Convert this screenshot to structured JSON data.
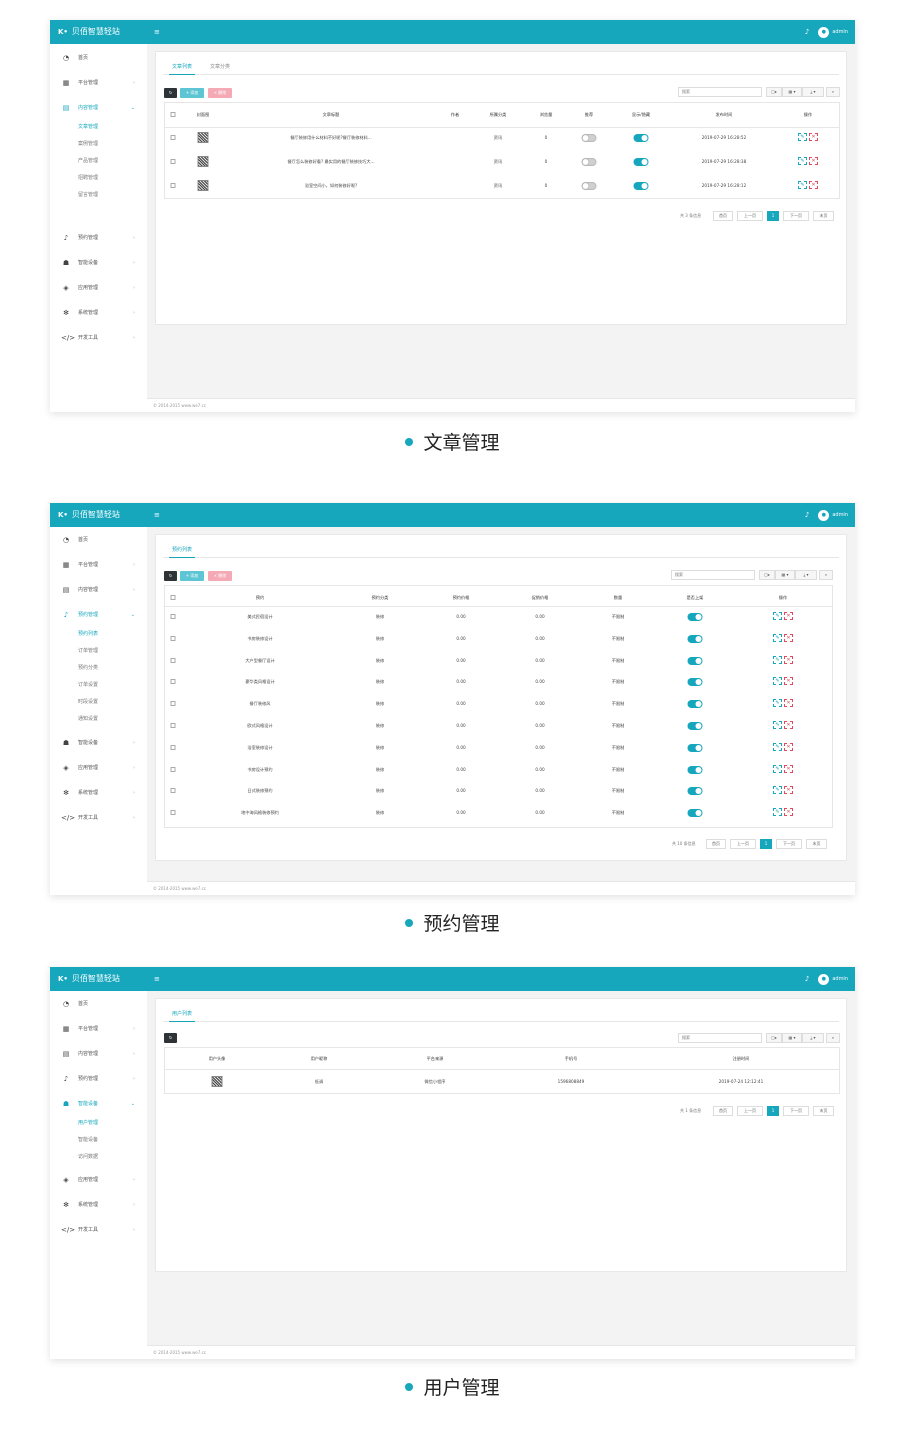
{
  "app": {
    "logo_mark": "K•",
    "title": "贝佰智慧轻站",
    "menu_toggle": "≡",
    "bell": "♪",
    "avatar": "●",
    "user": "admin",
    "footer": "© 2014-2015 www.we7.cc",
    "accent_color": "#17a7bd"
  },
  "sidebar_labels": {
    "home": "首页",
    "platform": "平台管理",
    "content": "内容管理",
    "booking": "预约管理",
    "member": "智能设备",
    "app": "应用管理",
    "system": "系统管理",
    "dev": "开发工具",
    "arrow": "›"
  },
  "content_sub": [
    "文章管理",
    "案例管理",
    "产品管理",
    "招聘管理",
    "留言管理"
  ],
  "booking_sub": [
    "预约列表",
    "订单管理",
    "预约分类",
    "订单设置",
    "时段设置",
    "通知设置"
  ],
  "member_sub": [
    "用户管理",
    "智能设备",
    "访问数据"
  ],
  "toolbar": {
    "refresh": "↻",
    "add": "+ 添加",
    "delete": "× 删除",
    "search_placeholder": "搜索",
    "view": "▢▸",
    "columns": "▦ ▾",
    "export": "⤓ ▾",
    "search_btn": "⌕"
  },
  "pager": {
    "first": "首页",
    "prev": "上一页",
    "current": "1",
    "next": "下一页",
    "last": "末页"
  },
  "ops": {
    "edit": "✎",
    "delete": "✕"
  },
  "article": {
    "tabs": [
      "文章列表",
      "文章分类"
    ],
    "headers": [
      "封面图",
      "文章标题",
      "作者",
      "所属分类",
      "浏览量",
      "推荐",
      "显示/隐藏",
      "发布时间",
      "操作"
    ],
    "rows": [
      {
        "title": "餐厅装修用什么材料不好呢?餐厅装修材料...",
        "author": "",
        "category": "资讯",
        "views": "0",
        "recommend": false,
        "visible": true,
        "time": "2019-07-29 16:28:52"
      },
      {
        "title": "餐厅怎么装修好看? 最实用的餐厅装修技巧大...",
        "author": "",
        "category": "资讯",
        "views": "0",
        "recommend": false,
        "visible": true,
        "time": "2019-07-29 16:28:38"
      },
      {
        "title": "浴室空间小，如何装修好呢?",
        "author": "",
        "category": "资讯",
        "views": "0",
        "recommend": false,
        "visible": true,
        "time": "2019-07-29 16:28:12"
      }
    ],
    "total": "共 3 条信息"
  },
  "booking": {
    "tabs": [
      "预约列表"
    ],
    "headers": [
      "预约",
      "预约分类",
      "预约价格",
      "促销价格",
      "数量",
      "是否上架",
      "操作"
    ],
    "rows": [
      {
        "name": "美式民宿设计",
        "category": "装修",
        "price": "0.00",
        "promo": "0.00",
        "qty": "不限制",
        "on": true
      },
      {
        "name": "书房装修设计",
        "category": "装修",
        "price": "0.00",
        "promo": "0.00",
        "qty": "不限制",
        "on": true
      },
      {
        "name": "大户型餐厅设计",
        "category": "装修",
        "price": "0.00",
        "promo": "0.00",
        "qty": "不限制",
        "on": true
      },
      {
        "name": "豪华类风格设计",
        "category": "装修",
        "price": "0.00",
        "promo": "0.00",
        "qty": "不限制",
        "on": true
      },
      {
        "name": "餐厅装修风",
        "category": "装修",
        "price": "0.00",
        "promo": "0.00",
        "qty": "不限制",
        "on": true
      },
      {
        "name": "欧式风格设计",
        "category": "装修",
        "price": "0.00",
        "promo": "0.00",
        "qty": "不限制",
        "on": true
      },
      {
        "name": "浴室装修设计",
        "category": "装修",
        "price": "0.00",
        "promo": "0.00",
        "qty": "不限制",
        "on": true
      },
      {
        "name": "书房设计预约",
        "category": "装修",
        "price": "0.00",
        "promo": "0.00",
        "qty": "不限制",
        "on": true
      },
      {
        "name": "日式装修预约",
        "category": "装修",
        "price": "0.00",
        "promo": "0.00",
        "qty": "不限制",
        "on": true
      },
      {
        "name": "地中海风格装修预约",
        "category": "装修",
        "price": "0.00",
        "promo": "0.00",
        "qty": "不限制",
        "on": true
      }
    ],
    "total": "共 10 条信息"
  },
  "users": {
    "tabs": [
      "用户列表"
    ],
    "headers": [
      "用户头像",
      "用户昵称",
      "平台来源",
      "手机号",
      "注册时间"
    ],
    "rows": [
      {
        "nickname": "低调",
        "source": "微信小程序",
        "phone": "1596808849",
        "time": "2019-07-24 12:12:41"
      }
    ],
    "total": "共 1 条信息"
  },
  "captions": [
    "文章管理",
    "预约管理",
    "用户管理"
  ]
}
